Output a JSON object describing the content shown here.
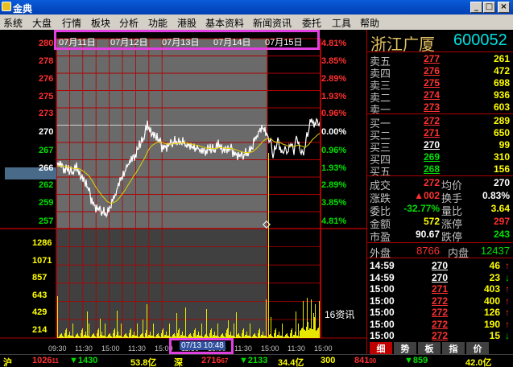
{
  "window": {
    "title": "金典",
    "btn_min": "_",
    "btn_max": "□",
    "btn_close": "×"
  },
  "menu": [
    "系统",
    "大盘",
    "行情",
    "板块",
    "分析",
    "功能",
    "港股",
    "基本资料",
    "新闻资讯",
    "委托",
    "工具",
    "帮助"
  ],
  "dates": [
    "07月11日",
    "07月12日",
    "07月13日",
    "07月14日",
    "07月15日"
  ],
  "price_axis": [
    {
      "p": "280",
      "c": "red"
    },
    {
      "p": "278",
      "c": "red"
    },
    {
      "p": "276",
      "c": "red"
    },
    {
      "p": "275",
      "c": "red"
    },
    {
      "p": "273",
      "c": "red"
    },
    {
      "p": "270",
      "c": "white"
    },
    {
      "p": "267",
      "c": "green"
    },
    {
      "p": "266",
      "c": "sel"
    },
    {
      "p": "262",
      "c": "green"
    },
    {
      "p": "259",
      "c": "green"
    },
    {
      "p": "257",
      "c": "green"
    }
  ],
  "pct_axis": [
    {
      "p": "4.81%",
      "c": "red"
    },
    {
      "p": "3.85%",
      "c": "red"
    },
    {
      "p": "2.89%",
      "c": "red"
    },
    {
      "p": "1.93%",
      "c": "red"
    },
    {
      "p": "0.96%",
      "c": "red"
    },
    {
      "p": "0.00%",
      "c": "white"
    },
    {
      "p": "0.96%",
      "c": "green"
    },
    {
      "p": "1.93%",
      "c": "green"
    },
    {
      "p": "2.89%",
      "c": "green"
    },
    {
      "p": "3.85%",
      "c": "green"
    },
    {
      "p": "4.81%",
      "c": "green"
    }
  ],
  "vol_axis": [
    "1286",
    "1071",
    "857",
    "643",
    "429",
    "214"
  ],
  "time_axis": [
    "09:30",
    "11:30",
    "15:00",
    "11:30",
    "15:00",
    "11:30",
    "15:00",
    "11:30",
    "15:00",
    "11:30",
    "15:00"
  ],
  "news_label": "16资讯",
  "stock": {
    "name": "浙江广厦",
    "code": "600052"
  },
  "sell": [
    {
      "l": "卖五",
      "p": "277",
      "v": "261"
    },
    {
      "l": "卖四",
      "p": "276",
      "v": "472"
    },
    {
      "l": "卖三",
      "p": "275",
      "v": "698"
    },
    {
      "l": "卖二",
      "p": "274",
      "v": "936"
    },
    {
      "l": "卖一",
      "p": "273",
      "v": "603"
    }
  ],
  "buy": [
    {
      "l": "买一",
      "p": "272",
      "v": "289"
    },
    {
      "l": "买二",
      "p": "271",
      "v": "650"
    },
    {
      "l": "买三",
      "p": "270",
      "v": "99"
    },
    {
      "l": "买四",
      "p": "269",
      "v": "310"
    },
    {
      "l": "买五",
      "p": "268",
      "v": "156"
    }
  ],
  "stats": [
    {
      "l1": "成交",
      "v1": "272",
      "c1": "red",
      "l2": "均价",
      "v2": "270",
      "c2": "white"
    },
    {
      "l1": "涨跌",
      "v1": "▲002",
      "c1": "red",
      "l2": "换手",
      "v2": "0.83%",
      "c2": "white"
    },
    {
      "l1": "委比",
      "v1": "-32.77%",
      "c1": "green",
      "l2": "量比",
      "v2": "3.64",
      "c2": "yellow"
    },
    {
      "l1": "金额",
      "v1": "572",
      "c1": "yellow",
      "l2": "涨停",
      "v2": "297",
      "c2": "red"
    },
    {
      "l1": "市盈",
      "v1": "90.67",
      "c1": "white",
      "l2": "跌停",
      "v2": "243",
      "c2": "green"
    }
  ],
  "outer": {
    "l1": "外盘",
    "v1": "8766",
    "l2": "内盘",
    "v2": "12437"
  },
  "ticks": [
    {
      "t": "14:59",
      "p": "270",
      "v": "46",
      "d": "↑",
      "c": "red"
    },
    {
      "t": "14:59",
      "p": "270",
      "v": "23",
      "d": "↓",
      "c": "green"
    },
    {
      "t": "15:00",
      "p": "271",
      "v": "403",
      "d": "↑",
      "c": "red"
    },
    {
      "t": "15:00",
      "p": "272",
      "v": "400",
      "d": "↑",
      "c": "red"
    },
    {
      "t": "15:00",
      "p": "272",
      "v": "126",
      "d": "↑",
      "c": "red"
    },
    {
      "t": "15:00",
      "p": "272",
      "v": "190",
      "d": "↑",
      "c": "red"
    },
    {
      "t": "15:00",
      "p": "272",
      "v": "15",
      "d": "↓",
      "c": "green"
    }
  ],
  "tabs": [
    "细",
    "势",
    "板",
    "指",
    "价"
  ],
  "timebox": "07/13 10:48",
  "status": {
    "s1": "沪",
    "s2": "1026",
    "s2b": "11",
    "s3": "▼1430",
    "s4": "53.8亿",
    "s5": "深",
    "s6": "2716",
    "s6b": "67",
    "s7": "▼2133",
    "s8": "34.4亿",
    "s9": "300",
    "s10": "841",
    "s10b": "00",
    "s11": "▼859",
    "s12": "42.0亿"
  },
  "colors": {
    "red": "#ff3030",
    "green": "#00e000",
    "white": "#ffffff",
    "yellow": "#ffff00",
    "grid": "#b00000"
  }
}
